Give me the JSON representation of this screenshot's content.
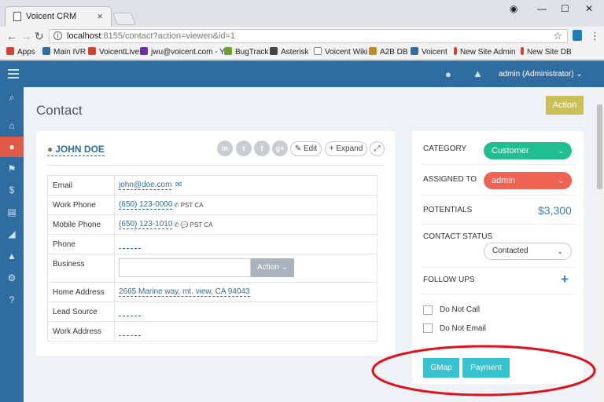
{
  "browser": {
    "tab_title": "Voicent CRM",
    "tab_close": "×",
    "url_host": "localhost",
    "url_rest": ":8155/contact?action=viewen&id=1",
    "bookmarks": [
      {
        "label": "Apps",
        "color": "#d0442f"
      },
      {
        "label": "Main IVR",
        "color": "#2f6da1"
      },
      {
        "label": "VoicentLive",
        "color": "#d0442f"
      },
      {
        "label": "jwu@voicent.com - Y",
        "color": "#6b2fa1"
      },
      {
        "label": "BugTrack",
        "color": "#6aa12f"
      },
      {
        "label": "Asterisk",
        "color": "#444444"
      },
      {
        "label": "Voicent Wiki",
        "color": "#888888"
      },
      {
        "label": "A2B DB",
        "color": "#c08a2f"
      },
      {
        "label": "Voicent",
        "color": "#2f6da1"
      },
      {
        "label": "New Site Admin",
        "color": "#d0442f"
      },
      {
        "label": "New Site DB",
        "color": "#d0442f"
      }
    ]
  },
  "header": {
    "user_menu": "admin (Administrator) ⌄"
  },
  "page": {
    "title": "Contact",
    "action_button": "Action"
  },
  "contact": {
    "name": "JOHN DOE",
    "social": [
      "in",
      "t",
      "f",
      "g+"
    ],
    "edit_label": "✎ Edit",
    "expand_label": "+ Expand",
    "fields": {
      "email_label": "Email",
      "email_value": "john@doe.com",
      "work_phone_label": "Work Phone",
      "work_phone_value": "(650) 123-0000",
      "work_phone_tz": "PST CA",
      "mobile_phone_label": "Mobile Phone",
      "mobile_phone_value": "(650) 123-1010",
      "mobile_phone_tz": "PST CA",
      "phone_label": "Phone",
      "business_label": "Business",
      "business_action": "Action ⌄",
      "home_address_label": "Home Address",
      "home_address_value": "2665 Marine way, mt. view, CA 94043",
      "lead_source_label": "Lead Source",
      "work_address_label": "Work Address"
    }
  },
  "details": {
    "category_label": "CATEGORY",
    "category_value": "Customer",
    "category_color": "#1fbf8f",
    "assigned_label": "ASSIGNED TO",
    "assigned_value": "admin",
    "assigned_color": "#ee6352",
    "potentials_label": "POTENTIALS",
    "potentials_value": "$3,300",
    "status_label": "CONTACT STATUS",
    "status_value": "Contacted",
    "followups_label": "FOLLOW UPS",
    "do_not_call": "Do Not Call",
    "do_not_email": "Do Not Email",
    "gmap_button": "GMap",
    "payment_button": "Payment"
  }
}
